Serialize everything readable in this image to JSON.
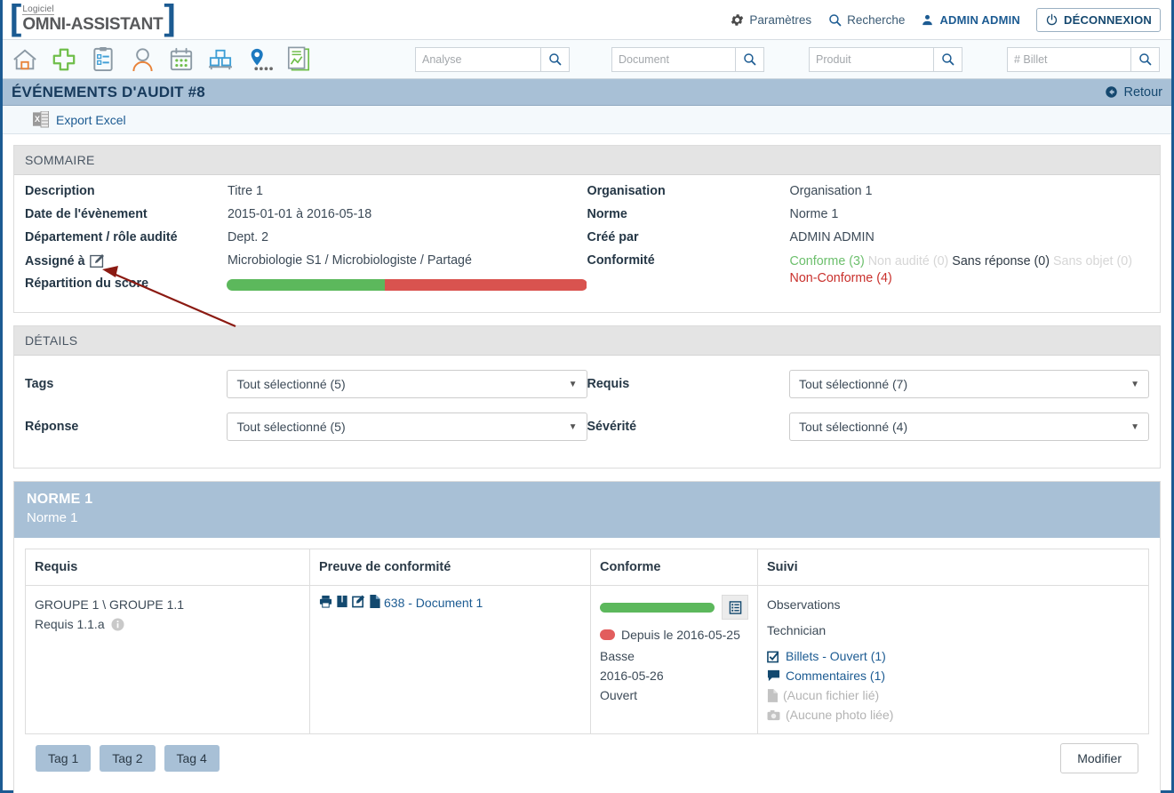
{
  "header": {
    "logo_small": "Logiciel",
    "logo_main": "OMNI-ASSISTANT",
    "settings_label": "Paramètres",
    "search_label": "Recherche",
    "user_name": "ADMIN ADMIN",
    "logout_label": "DÉCONNEXION"
  },
  "nav": {
    "icons": [
      {
        "name": "home-icon"
      },
      {
        "name": "plus-cross-icon"
      },
      {
        "name": "clipboard-checklist-icon"
      },
      {
        "name": "user-icon"
      },
      {
        "name": "calendar-icon"
      },
      {
        "name": "pallet-boxes-icon"
      },
      {
        "name": "location-pin-icon"
      },
      {
        "name": "report-chart-icon"
      }
    ],
    "searches": [
      {
        "name": "analyse",
        "placeholder": "Analyse",
        "value": ""
      },
      {
        "name": "document",
        "placeholder": "Document",
        "value": ""
      },
      {
        "name": "produit",
        "placeholder": "Produit",
        "value": ""
      },
      {
        "name": "billet",
        "placeholder": "# Billet",
        "value": ""
      }
    ]
  },
  "titlebar": {
    "title": "ÉVÉNEMENTS D'AUDIT #8",
    "back_label": "Retour"
  },
  "actionbar": {
    "export_label": "Export Excel"
  },
  "summary": {
    "panel_title": "SOMMAIRE",
    "left": [
      {
        "label": "Description",
        "value": "Titre 1"
      },
      {
        "label": "Date de l'évènement",
        "value": "2015-01-01 à 2016-05-18"
      },
      {
        "label": "Département / rôle audité",
        "value": "Dept. 2"
      },
      {
        "label": "Assigné à",
        "value": "Microbiologie S1 / Microbiologiste / Partagé"
      },
      {
        "label": "Répartition du score",
        "value": ""
      }
    ],
    "right": [
      {
        "label": "Organisation",
        "value": "Organisation 1"
      },
      {
        "label": "Norme",
        "value": "Norme 1"
      },
      {
        "label": "Créé par",
        "value": "ADMIN ADMIN"
      }
    ],
    "conformity_label": "Conformité",
    "conformity": [
      {
        "text": "Conforme (3)",
        "color": "#6cbf6c"
      },
      {
        "text": "Non audité (0)",
        "color": "#d6d6d6"
      },
      {
        "text": "Sans réponse (0)",
        "color": "#2f3a45"
      },
      {
        "text": "Sans objet (0)",
        "color": "#d6d6d6"
      },
      {
        "text": "Non-Conforme (4)",
        "color": "#c9302c"
      }
    ],
    "score": {
      "green_percent": 44,
      "red_percent": 56,
      "green_color": "#5cb85c",
      "red_color": "#d9534f"
    }
  },
  "details": {
    "panel_title": "DÉTAILS",
    "fields": [
      {
        "label": "Tags",
        "value": "Tout sélectionné (5)"
      },
      {
        "label": "Requis",
        "value": "Tout sélectionné (7)"
      },
      {
        "label": "Réponse",
        "value": "Tout sélectionné (5)"
      },
      {
        "label": "Sévérité",
        "value": "Tout sélectionné (4)"
      }
    ]
  },
  "norme": {
    "title": "NORME 1",
    "subtitle": "Norme 1",
    "columns": [
      "Requis",
      "Preuve de conformité",
      "Conforme",
      "Suivi"
    ],
    "rows": [
      {
        "requis_group": "GROUPE 1 \\ GROUPE 1.1",
        "requis_name": "Requis 1.1.a",
        "preuve_doc": "638 - Document 1",
        "conforme": {
          "bar_percent": 100,
          "bar_color": "#5cb85c",
          "since": "Depuis le 2016-05-25",
          "since_dot_color": "#e25d5d",
          "severity": "Basse",
          "date": "2016-05-26",
          "status": "Ouvert"
        },
        "suivi": {
          "observations": "Observations",
          "technician": "Technician",
          "tickets": "Billets - Ouvert (1)",
          "comments": "Commentaires (1)",
          "no_file": "(Aucun fichier lié)",
          "no_photo": "(Aucune photo liée)"
        }
      }
    ],
    "tags": [
      "Tag 1",
      "Tag 2",
      "Tag 4"
    ],
    "modify_label": "Modifier"
  }
}
